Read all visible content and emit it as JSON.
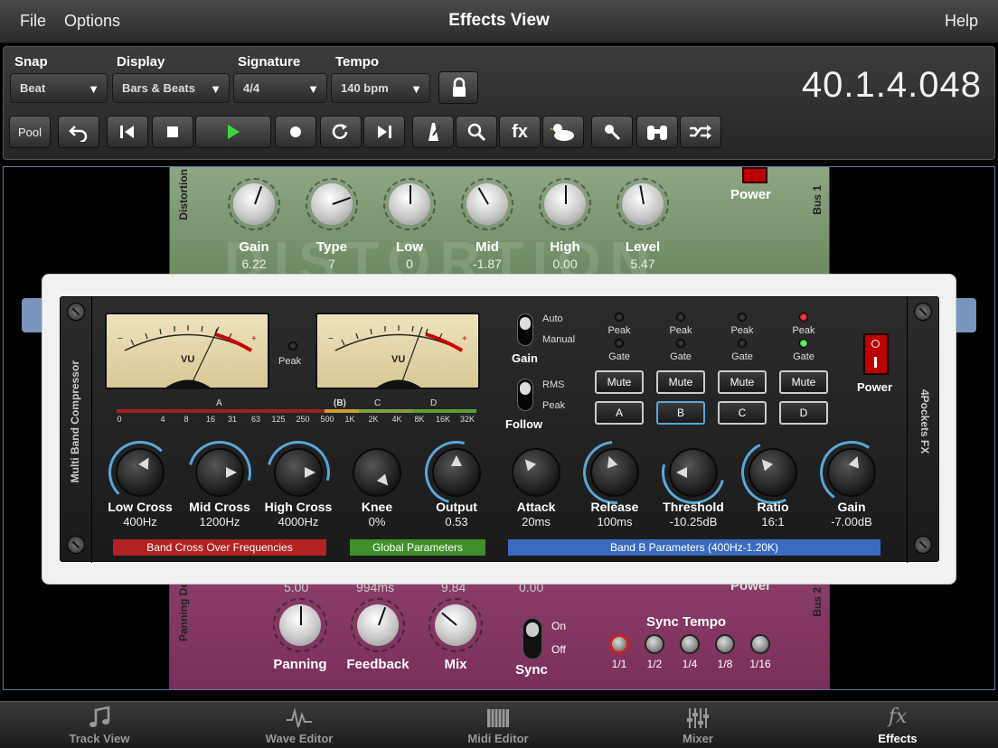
{
  "menu": {
    "file": "File",
    "options": "Options",
    "title": "Effects View",
    "help": "Help"
  },
  "toolbar": {
    "snap": {
      "label": "Snap",
      "value": "Beat"
    },
    "display": {
      "label": "Display",
      "value": "Bars & Beats"
    },
    "signature": {
      "label": "Signature",
      "value": "4/4"
    },
    "tempo": {
      "label": "Tempo",
      "value": "140 bpm"
    },
    "position": "40.1.4.048",
    "pool": "Pool",
    "fx": "fx"
  },
  "distortion": {
    "name": "Distortion",
    "bus": "Bus 1",
    "power": "Power",
    "watermark": "DISTORTION",
    "knobs": [
      {
        "label": "Gain",
        "value": "6.22"
      },
      {
        "label": "Type",
        "value": "7"
      },
      {
        "label": "Low",
        "value": "0"
      },
      {
        "label": "Mid",
        "value": "-1.87"
      },
      {
        "label": "High",
        "value": "0.00"
      },
      {
        "label": "Level",
        "value": "5.47"
      }
    ]
  },
  "compressor": {
    "name": "Multi Band Compressor",
    "brand": "4Pockets FX",
    "vu_label": "VU",
    "peak": "Peak",
    "scale": {
      "bands": [
        "A",
        "(B)",
        "C",
        "D"
      ],
      "freqs": [
        "0",
        "4",
        "8",
        "16",
        "31",
        "63",
        "125",
        "250",
        "500",
        "1K",
        "2K",
        "4K",
        "8K",
        "16K",
        "32K"
      ]
    },
    "gain_switch": {
      "label": "Gain",
      "opt1": "Auto",
      "opt2": "Manual"
    },
    "follow_switch": {
      "label": "Follow",
      "opt1": "RMS",
      "opt2": "Peak"
    },
    "band_controls": [
      {
        "peak": "Peak",
        "gate": "Gate",
        "mute": "Mute",
        "band": "A"
      },
      {
        "peak": "Peak",
        "gate": "Gate",
        "mute": "Mute",
        "band": "B"
      },
      {
        "peak": "Peak",
        "gate": "Gate",
        "mute": "Mute",
        "band": "C"
      },
      {
        "peak": "Peak",
        "gate": "Gate",
        "mute": "Mute",
        "band": "D"
      }
    ],
    "power": "Power",
    "knobs": [
      {
        "label": "Low Cross",
        "value": "400Hz"
      },
      {
        "label": "Mid Cross",
        "value": "1200Hz"
      },
      {
        "label": "High Cross",
        "value": "4000Hz"
      },
      {
        "label": "Knee",
        "value": "0%"
      },
      {
        "label": "Output",
        "value": "0.53"
      },
      {
        "label": "Attack",
        "value": "20ms"
      },
      {
        "label": "Release",
        "value": "100ms"
      },
      {
        "label": "Threshold",
        "value": "-10.25dB"
      },
      {
        "label": "Ratio",
        "value": "16:1"
      },
      {
        "label": "Gain",
        "value": "-7.00dB"
      }
    ],
    "sections": {
      "band_cross": "Band Cross Over Frequencies",
      "global": "Global Parameters",
      "band_b": "Band B Parameters (400Hz-1.20K)"
    }
  },
  "panning_delay": {
    "name": "Panning De",
    "bus": "Bus 2",
    "power": "Power",
    "top_values": [
      "5.00",
      "994ms",
      "9.84",
      "0.00"
    ],
    "knobs": [
      {
        "label": "Panning"
      },
      {
        "label": "Feedback"
      },
      {
        "label": "Mix"
      }
    ],
    "sync": {
      "label": "Sync",
      "on": "On",
      "off": "Off"
    },
    "sync_tempo": {
      "label": "Sync Tempo",
      "options": [
        "1/1",
        "1/2",
        "1/4",
        "1/8",
        "1/16"
      ]
    }
  },
  "tabs": [
    {
      "label": "Track View",
      "icon": "music-note-icon"
    },
    {
      "label": "Wave Editor",
      "icon": "waveform-icon"
    },
    {
      "label": "Midi Editor",
      "icon": "piano-keys-icon"
    },
    {
      "label": "Mixer",
      "icon": "mixer-faders-icon"
    },
    {
      "label": "Effects",
      "icon": "fx-icon"
    }
  ],
  "colors": {
    "accent_blue": "#5aa8d8",
    "band_red": "#b22222",
    "band_green": "#3f8f2a",
    "band_blue": "#3a6bc0"
  }
}
